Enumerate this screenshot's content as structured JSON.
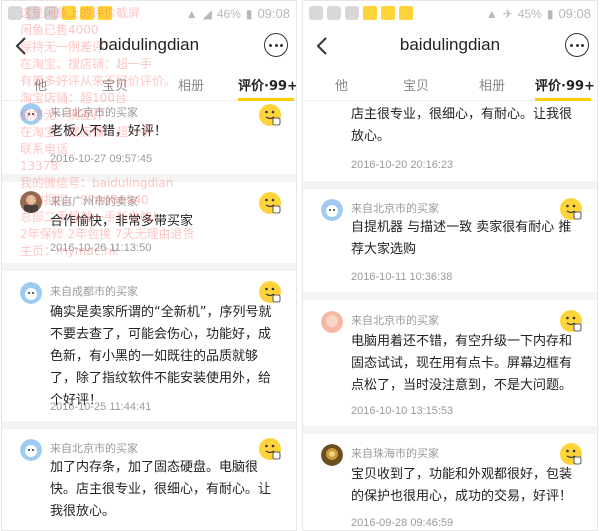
{
  "status_left": {
    "battery": "46%",
    "time": "09:08"
  },
  "status_right": {
    "battery": "45%",
    "time": "09:08"
  },
  "shop_name": "baidulingdian",
  "tabs": [
    "他",
    "宝贝",
    "相册",
    "评价·99+"
  ],
  "left_reviews": [
    {
      "from": "来自北京市的买家",
      "body": "老板人不错，好评！",
      "date": "2016-10-27 09:57:45",
      "avatar": "avatar-cartoon"
    },
    {
      "from": "来自广州市的卖家",
      "body": "合作愉快，非常多带买家",
      "date": "2016-10-26 11:13:50",
      "avatar": "avatar-photo"
    },
    {
      "from": "来自成都市的买家",
      "body": "确实是卖家所谓的“全新机”，序列号就不要去查了，可能会伤心，功能好，成色新，有小黑的一如既往的品质就够了，除了指纹软件不能安装使用外，给个好评！",
      "date": "2016-10-25 11:44:41",
      "avatar": "avatar-cartoon"
    },
    {
      "from": "来自北京市的买家",
      "body": "加了内存条，加了固态硬盘。电脑很快。店主很专业，很细心，有耐心。让我很放心。",
      "date": "2016-10-20 20:16:23",
      "avatar": "avatar-cartoon"
    }
  ],
  "right_reviews": [
    {
      "from": "",
      "body": "店主很专业，很细心，有耐心。让我很放心。",
      "date": "2016-10-20 20:16:23",
      "avatar": ""
    },
    {
      "from": "来自北京市的买家",
      "body": "自提机器 与描述一致 卖家很有耐心 推荐大家选购",
      "date": "2016-10-11 10:36:38",
      "avatar": "avatar-cartoon"
    },
    {
      "from": "来自北京市的买家",
      "body": "电脑用着还不错，有空升级一下内存和固态试试，现在用有点卡。屏幕边框有点松了，当时没注意到，不是大问题。",
      "date": "2016-10-10 13:15:53",
      "avatar": "avatar-peach"
    },
    {
      "from": "来自珠海市的买家",
      "body": "宝贝收到了，功能和外观都很好，包装的保护也很用心，成功的交易，好评！",
      "date": "2016-09-28 09:46:59",
      "avatar": "avatar-gold"
    }
  ],
  "watermark_lines": [
    "这是闲鱼上的评价截屏",
    "闲鱼已售4000",
    "保持无一例差评",
    "在淘宝、搜店铺：超一手",
    "有更多好评从来不好价评价。",
    "淘宝店铺：超100台",
    "保持无一例差评",
    "在淘宝，搜店铺：超一手",
    "联系电话",
    "13378",
    "我的微信号：baidulingdian",
    "我的扣扣：370686940",
    "总部二手超越一手新电脑！",
    "2年保修 2年包换 7天无理由退货",
    "主页：mymac.hk"
  ],
  "colors": {
    "accent": "#ffcc00",
    "watermark": "#ff4d4d",
    "text": "#222222",
    "muted": "#9a9a9a"
  },
  "icons": [
    "back-arrow-icon",
    "more-menu-icon",
    "thumbs-up-smiley-icon"
  ]
}
